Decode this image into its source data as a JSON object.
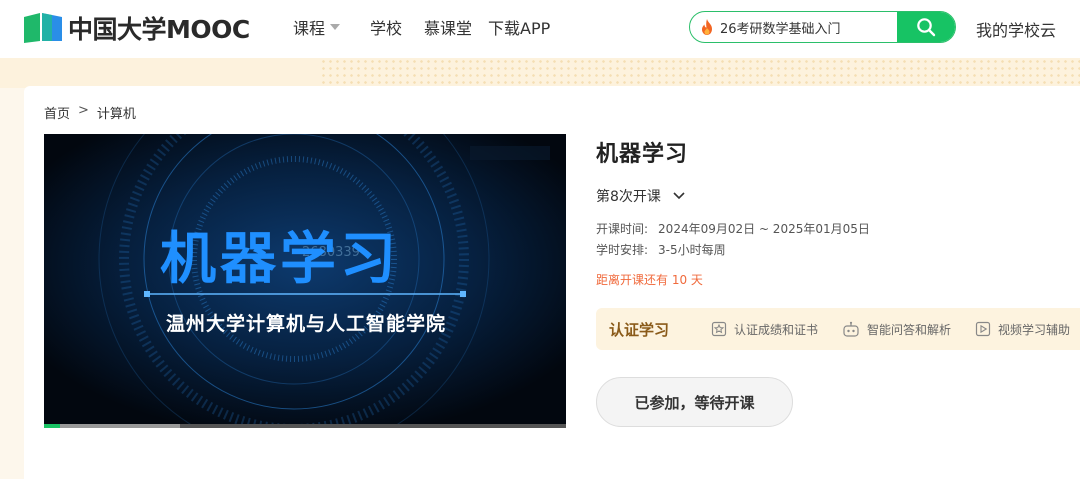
{
  "header": {
    "logo_text": "中国大学MOOC",
    "nav": [
      {
        "label": "课程",
        "has_dropdown": true
      },
      {
        "label": "学校",
        "has_dropdown": false
      },
      {
        "label": "慕课堂",
        "has_dropdown": false
      },
      {
        "label": "下载APP",
        "has_dropdown": false
      }
    ],
    "search": {
      "hot_text": "26考研数学基础入门"
    },
    "my_school": "我的学校云"
  },
  "breadcrumb": {
    "home": "首页",
    "separator": ">",
    "current": "计算机"
  },
  "video": {
    "title_art": "机器学习",
    "subtitle_art": "温州大学计算机与人工智能学院",
    "watermark": "2680339",
    "progress": {
      "played_fraction": 0.03,
      "buffered_fraction": 0.26
    }
  },
  "course": {
    "title": "机器学习",
    "term": "第8次开课",
    "schedule_label": "开课时间:",
    "schedule_value": "2024年09月02日 ~ 2025年01月05日",
    "hours_label": "学时安排:",
    "hours_value": "3-5小时每周",
    "countdown": "距离开课还有 10 天"
  },
  "certification": {
    "title": "认证学习",
    "items": [
      "认证成绩和证书",
      "智能问答和解析",
      "视频学习辅助"
    ]
  },
  "join_button": "已参加，等待开课",
  "colors": {
    "brand_green": "#17c364",
    "accent_orange": "#f06a3c",
    "cert_gold": "#8a5a19"
  }
}
